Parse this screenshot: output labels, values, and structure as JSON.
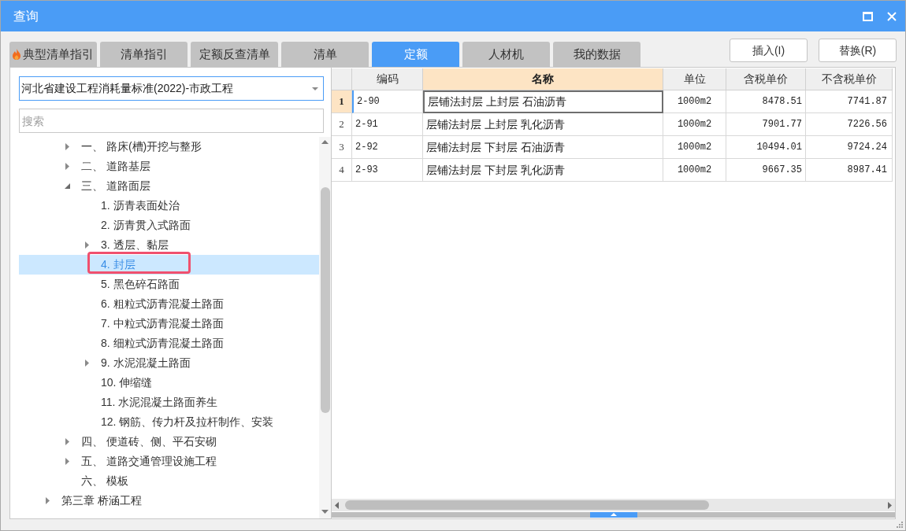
{
  "window": {
    "title": "查询"
  },
  "tabs": [
    {
      "label": "典型清单指引",
      "kind": "hot",
      "selected": false
    },
    {
      "label": "清单指引",
      "kind": "plain",
      "selected": false
    },
    {
      "label": "定额反查清单",
      "kind": "plain",
      "selected": false
    },
    {
      "label": "清单",
      "kind": "plain",
      "selected": false
    },
    {
      "label": "定额",
      "kind": "plain",
      "selected": true
    },
    {
      "label": "人材机",
      "kind": "plain",
      "selected": false
    },
    {
      "label": "我的数据",
      "kind": "plain",
      "selected": false
    }
  ],
  "buttons": [
    "插入(I)",
    "替换(R)"
  ],
  "library_select": {
    "value": "河北省建设工程消耗量标准(2022)-市政工程"
  },
  "search": {
    "placeholder": "搜索"
  },
  "tree": [
    {
      "children": [
        {
          "label": "一、 路床(槽)开挖与整形",
          "expanded": false,
          "selected": false,
          "marked": false
        },
        {
          "label": "二、 道路基层",
          "expanded": false,
          "selected": false,
          "marked": false
        },
        {
          "label": "三、 道路面层",
          "expanded": true,
          "selected": false,
          "marked": false,
          "children": [
            {
              "label": "1. 沥青表面处治",
              "selected": false,
              "marked": false
            },
            {
              "label": "2. 沥青贯入式路面",
              "selected": false,
              "marked": false
            },
            {
              "label": "3. 透层、黏层",
              "expanded": false,
              "selected": false,
              "marked": false
            },
            {
              "label": "4. 封层",
              "selected": true,
              "marked": true
            },
            {
              "label": "5. 黑色碎石路面",
              "selected": false,
              "marked": false
            },
            {
              "label": "6. 粗粒式沥青混凝土路面",
              "selected": false,
              "marked": false
            },
            {
              "label": "7. 中粒式沥青混凝土路面",
              "selected": false,
              "marked": false
            },
            {
              "label": "8. 细粒式沥青混凝土路面",
              "selected": false,
              "marked": false
            },
            {
              "label": "9. 水泥混凝土路面",
              "expanded": false,
              "selected": false,
              "marked": false
            },
            {
              "label": "10. 伸缩缝",
              "selected": false,
              "marked": false
            },
            {
              "label": "11. 水泥混凝土路面养生",
              "selected": false,
              "marked": false
            },
            {
              "label": "12. 钢筋、传力杆及拉杆制作、安装",
              "selected": false,
              "marked": false
            }
          ]
        },
        {
          "label": "四、 便道砖、侧、平石安砌",
          "expanded": false,
          "selected": false,
          "marked": false
        },
        {
          "label": "五、 道路交通管理设施工程",
          "expanded": false,
          "selected": false,
          "marked": false
        },
        {
          "label": "六、 模板",
          "selected": false,
          "marked": false
        }
      ]
    },
    {
      "label": "第三章 桥涵工程",
      "expanded": false,
      "selected": false,
      "marked": false
    }
  ],
  "table": {
    "columns": [
      {
        "label": "编码",
        "selected": false
      },
      {
        "label": "名称",
        "selected": true
      },
      {
        "label": "单位",
        "selected": false
      },
      {
        "label": "含税单价",
        "selected": false
      },
      {
        "label": "不含税单价",
        "selected": false
      }
    ],
    "rows": [
      {
        "number": "1",
        "selected": true,
        "cells": [
          "2-90",
          "层铺法封层 上封层 石油沥青",
          "1000m2",
          "8478.51",
          "7741.87"
        ]
      },
      {
        "number": "2",
        "selected": false,
        "cells": [
          "2-91",
          "层铺法封层 上封层 乳化沥青",
          "1000m2",
          "7901.77",
          "7226.56"
        ]
      },
      {
        "number": "3",
        "selected": false,
        "cells": [
          "2-92",
          "层铺法封层 下封层 石油沥青",
          "1000m2",
          "10494.01",
          "9724.24"
        ]
      },
      {
        "number": "4",
        "selected": false,
        "cells": [
          "2-93",
          "层铺法封层 下封层 乳化沥青",
          "1000m2",
          "9667.35",
          "8987.41"
        ]
      }
    ]
  }
}
